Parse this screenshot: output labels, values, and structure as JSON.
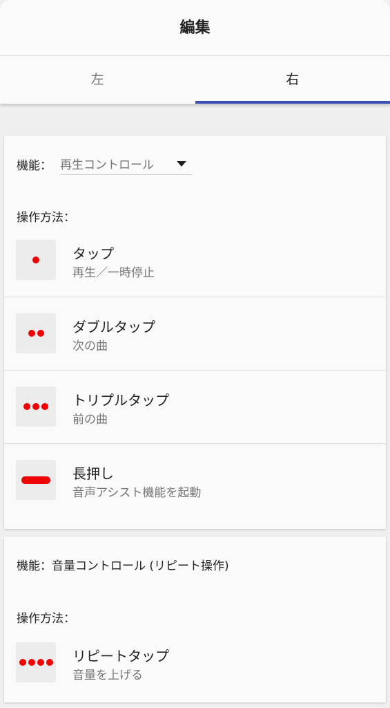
{
  "header": {
    "title": "編集",
    "tabs": [
      {
        "label": "左",
        "active": false
      },
      {
        "label": "右",
        "active": true
      }
    ],
    "accent_color": "#3f51b5"
  },
  "card1": {
    "function_label": "機能：",
    "function_value": "再生コントロール",
    "method_label": "操作方法：",
    "gestures": [
      {
        "icon": "single-dot-icon",
        "title": "タップ",
        "description": "再生／一時停止"
      },
      {
        "icon": "double-dot-icon",
        "title": "ダブルタップ",
        "description": "次の曲"
      },
      {
        "icon": "triple-dot-icon",
        "title": "トリプルタップ",
        "description": "前の曲"
      },
      {
        "icon": "long-press-bar-icon",
        "title": "長押し",
        "description": "音声アシスト機能を起動"
      }
    ]
  },
  "card2": {
    "function_text": "機能：音量コントロール (リピート操作)",
    "method_label": "操作方法：",
    "gestures": [
      {
        "icon": "quad-dot-icon",
        "title": "リピートタップ",
        "description": "音量を上げる"
      }
    ]
  },
  "icon_color": "#f00000"
}
